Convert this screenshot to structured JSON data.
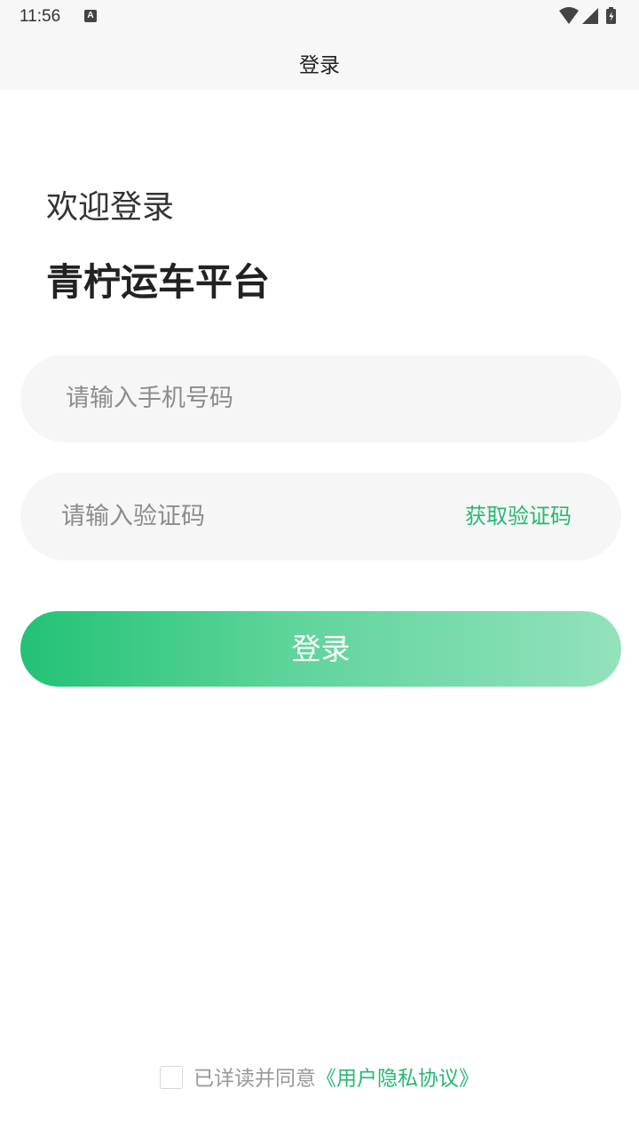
{
  "status_bar": {
    "time": "11:56",
    "notification_icon_letter": "A",
    "icons": [
      "wifi-icon",
      "cell-signal-icon",
      "battery-charging-icon"
    ]
  },
  "header": {
    "title": "登录"
  },
  "welcome": {
    "greeting": "欢迎登录",
    "platform_name": "青柠运车平台"
  },
  "form": {
    "phone_placeholder": "请输入手机号码",
    "phone_value": "",
    "code_placeholder": "请输入验证码",
    "code_value": "",
    "get_code_label": "获取验证码",
    "login_label": "登录"
  },
  "agreement": {
    "checked": false,
    "prefix": "已详读并同意",
    "link_label": "《用户隐私协议》"
  },
  "colors": {
    "accent": "#25b872",
    "button_gradient_start": "#22c275",
    "button_gradient_end": "#93e2bb",
    "field_background": "#f6f6f6",
    "bar_background": "#f7f7f7"
  }
}
